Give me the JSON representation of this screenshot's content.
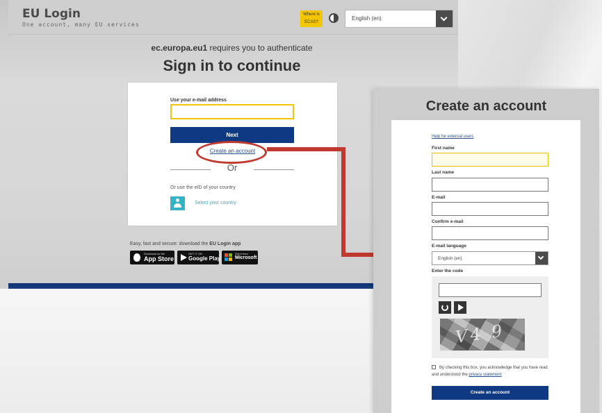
{
  "login": {
    "brand_title": "EU Login",
    "brand_subtitle": "One account, many EU services",
    "ecas_badge": "Where is ECAS?",
    "language_selected": "English (en)",
    "auth_site": "ec.europa.eu1",
    "auth_suffix": " requires you to authenticate",
    "heading": "Sign in to continue",
    "email_label": "Use your e-mail address",
    "email_value": "",
    "next_label": "Next",
    "create_account_link": "Create an account",
    "or_text": "Or",
    "eid_label": "Or use the eID of your country",
    "eid_select": "Select your country",
    "download_prefix": "Easy, fast and secure: download the ",
    "download_app": "EU Login app",
    "stores": {
      "apple_small": "Download on the",
      "apple_big": "App Store",
      "google_small": "GET IT ON",
      "google_big": "Google Play",
      "ms_small": "Get it from",
      "ms_big": "Microsoft"
    }
  },
  "create": {
    "heading": "Create an account",
    "help_link": "Help for external users",
    "first_name_label": "First name",
    "last_name_label": "Last name",
    "email_label": "E-mail",
    "confirm_email_label": "Confirm e-mail",
    "email_language_label": "E-mail language",
    "email_language_value": "English (en)",
    "code_label": "Enter the code",
    "captcha_text": "V4 9",
    "consent_text": "By checking this box, you acknowledge that you have read and understood the ",
    "privacy_link": "privacy statement",
    "submit_label": "Create an account"
  },
  "colors": {
    "eu_blue": "#0e3a84",
    "highlight_red": "#c0392f",
    "focus_yellow": "#f4c500",
    "eid_teal": "#34b3c4"
  }
}
